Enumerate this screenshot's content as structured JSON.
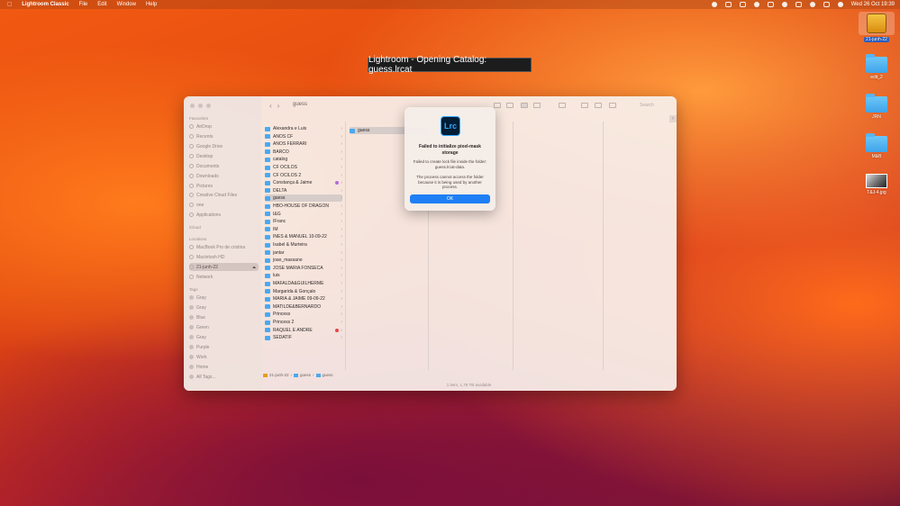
{
  "menubar": {
    "app_name": "Lightroom Classic",
    "menus": [
      "File",
      "Edit",
      "Window",
      "Help"
    ],
    "datetime": "Wed 26 Oct  19:39"
  },
  "desktop": {
    "items": [
      {
        "label": "21-junh-22",
        "kind": "drive"
      },
      {
        "label": "edit_2",
        "kind": "folder"
      },
      {
        "label": "JRN",
        "kind": "folder"
      },
      {
        "label": "M&B",
        "kind": "folder"
      },
      {
        "label": "T&J-4.jpg",
        "kind": "image"
      }
    ]
  },
  "lr_banner": "Lightroom - Opening Catalog: guess.lrcat",
  "finder": {
    "title": "guess",
    "search_placeholder": "Search",
    "sidebar": {
      "favourites_header": "Favourites",
      "favourites": [
        "AirDrop",
        "Recents",
        "Google Drive",
        "Desktop",
        "Documents",
        "Downloads",
        "Pictures",
        "Creative Cloud Files",
        "one",
        "Applications"
      ],
      "icloud_header": "iCloud",
      "locations_header": "Locations",
      "locations": [
        "MacBook Pro de cristina",
        "Macintosh HD",
        "21-junh-22",
        "Network"
      ],
      "tags_header": "Tags",
      "tags": [
        "Gray",
        "Gray",
        "Blue",
        "Green",
        "Gray",
        "Purple",
        "Work",
        "Home",
        "All Tags..."
      ]
    },
    "column1": [
      "Alexandra e Luis",
      "ANOS CF",
      "ANOS FERRARI",
      "BARCO",
      "catalog",
      "CF OCILOS",
      "CF OCILOS 2",
      "Constança & Jaime",
      "DELTA",
      "guess",
      "HBO-HOUSE OF DRAGON",
      "I&G",
      "IFranc",
      "IM",
      "INES & MANUEL 10-09-22",
      "Isabel & Murteira",
      "jantar",
      "joao_massano",
      "JOSE MARIA FONSECA",
      "luis",
      "MAFALDA&GUILHERME",
      "Margarida & Gonçalo",
      "MARIA & JAIME 09-09-22",
      "MATILDE&BERNARDO",
      "Princess",
      "Princess 2",
      "RAQUEL E ANDRE",
      "SEDATIF"
    ],
    "column2": [
      "guess"
    ],
    "path": [
      "21-junh-22",
      "guess",
      "guess"
    ],
    "status": "1 item, 1,79 TB available"
  },
  "alert": {
    "icon_text": "Lrc",
    "title": "Failed to initialize pixel-mask storage",
    "message1": "Failed to create lock file inside the folder: guess.lrcat-data.",
    "message2": "The process cannot access the folder because it is being used by another process.",
    "ok_label": "OK"
  }
}
